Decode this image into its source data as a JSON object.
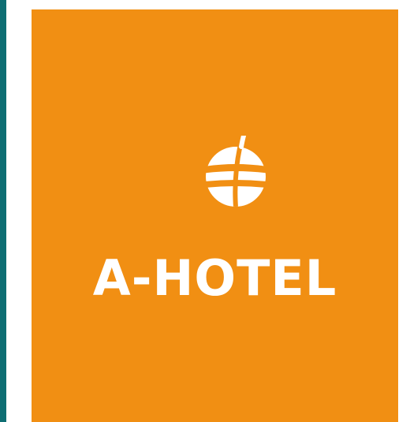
{
  "brand": {
    "name": "A-HOTEL",
    "logo_icon": "globe-icon"
  },
  "colors": {
    "panel": "#f18f13",
    "accent_bar": "#0e6e73",
    "logo": "#ffffff"
  }
}
